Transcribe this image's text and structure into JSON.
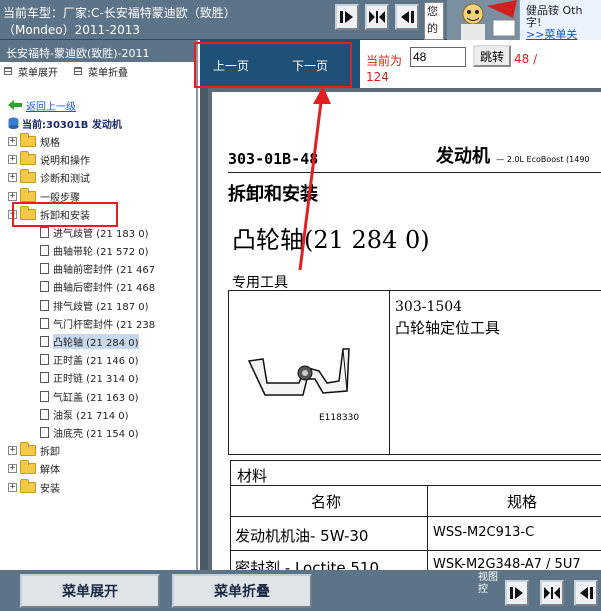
{
  "header": {
    "line1": "当前车型：厂家:C-长安福特蒙迪欧（致胜）",
    "line2": "（Mondeo）2011-2013",
    "small_text": "您的服务",
    "ad_line1": "健品铵  Oth",
    "ad_line2": "字!",
    "ad_link": ">>菜单关"
  },
  "left_panel": {
    "title": "长安福特-蒙迪欧(致胜)-2011",
    "expand_label": "菜单展开",
    "collapse_label": "菜单折叠",
    "back_label": "返回上一级",
    "current_label": "当前:30301B 发动机",
    "tree": [
      {
        "label": "规格",
        "type": "folder"
      },
      {
        "label": "说明和操作",
        "type": "folder"
      },
      {
        "label": "诊断和测试",
        "type": "folder"
      },
      {
        "label": "一般步骤",
        "type": "folder"
      },
      {
        "label": "拆卸和安装",
        "type": "folder-open"
      },
      {
        "label": "进气歧管 (21 183 0)",
        "type": "doc"
      },
      {
        "label": "曲轴带轮 (21 572 0)",
        "type": "doc"
      },
      {
        "label": "曲轴前密封件 (21 467",
        "type": "doc"
      },
      {
        "label": "曲轴后密封件 (21 468",
        "type": "doc"
      },
      {
        "label": "排气歧管 (21 187 0)",
        "type": "doc"
      },
      {
        "label": "气门杆密封件 (21 238",
        "type": "doc"
      },
      {
        "label": "凸轮轴 (21 284 0)",
        "type": "doc-selected"
      },
      {
        "label": "正时盖 (21 146 0)",
        "type": "doc"
      },
      {
        "label": "正时链 (21 314 0)",
        "type": "doc"
      },
      {
        "label": "气缸盖 (21 163 0)",
        "type": "doc"
      },
      {
        "label": "油泵 (21 714 0)",
        "type": "doc"
      },
      {
        "label": "油底壳 (21 154 0)",
        "type": "doc"
      },
      {
        "label": "拆卸",
        "type": "folder"
      },
      {
        "label": "解体",
        "type": "folder"
      },
      {
        "label": "安装",
        "type": "folder"
      }
    ]
  },
  "content_bar": {
    "prev_label": "上一页",
    "next_label": "下一页",
    "current_prefix": "当前为",
    "page_value": "48",
    "jump_label": "跳转",
    "page_total_a": "48 /",
    "page_total_b": "124"
  },
  "document": {
    "section": "303-01B-48",
    "engine": "发动机",
    "engine_sub": "— 2.0L EcoBoost (1490",
    "title": "拆卸和安装",
    "part_name": "凸轮轴(21 284 0)",
    "special_tools": "专用工具",
    "tool_code": "303-1504",
    "tool_desc": "凸轮轴定位工具",
    "figure_id": "E118330",
    "materials": "材料",
    "col_name": "名称",
    "col_spec": "规格",
    "row1_name": "发动机机油- 5W-30",
    "row1_spec": "WSS-M2C913-C",
    "row2_name": "密封剂 - Loctite 510",
    "row2_spec": "WSK-M2G348-A7 / 5U7"
  },
  "bottom_bar": {
    "expand_label": "菜单展开",
    "collapse_label": "菜单折叠",
    "view_label": "视图控"
  },
  "colors": {
    "header_bg": "#5d7488",
    "content_bar_bg": "#1f5077",
    "highlight": "#e02020",
    "page_count": "#e02020"
  }
}
